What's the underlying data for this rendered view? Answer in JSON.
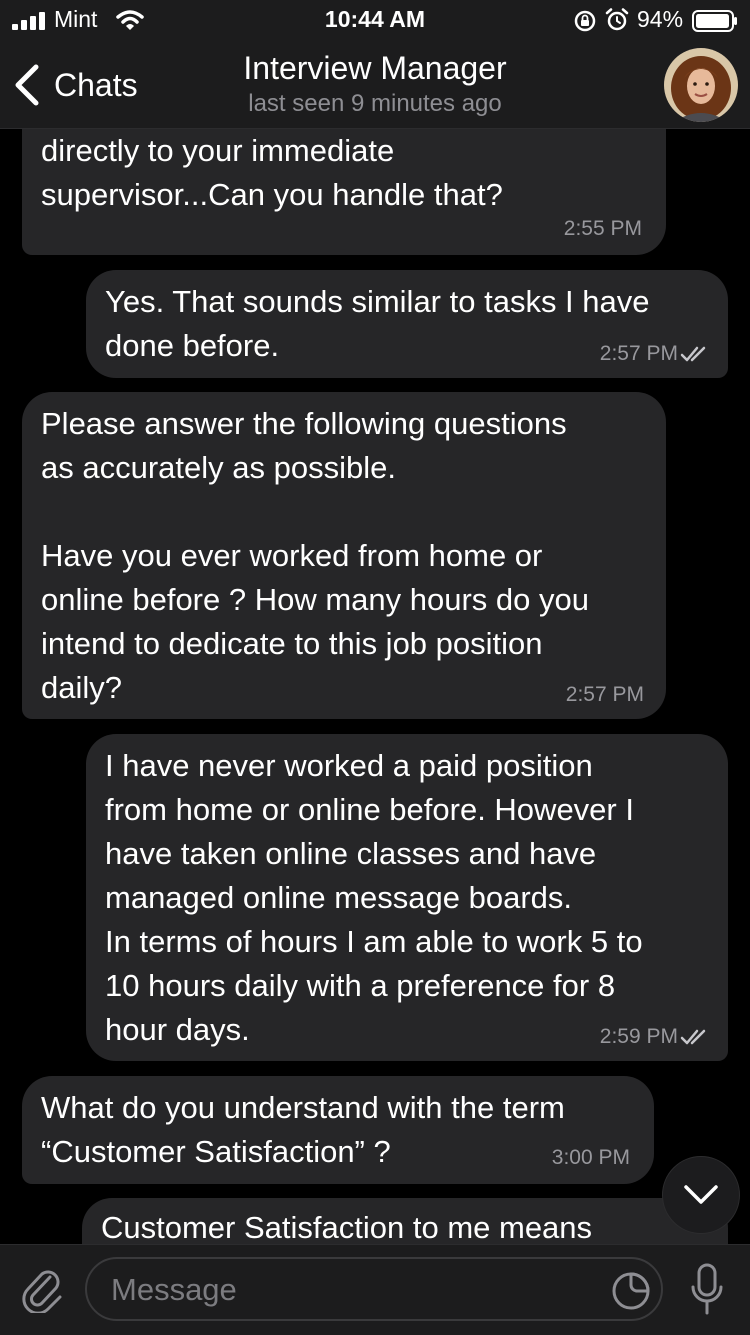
{
  "status_bar": {
    "carrier": "Mint",
    "time": "10:44 AM",
    "battery": "94%"
  },
  "header": {
    "back_label": "Chats",
    "title": "Interview Manager",
    "subtitle": "last seen 9 minutes ago"
  },
  "messages": [
    {
      "direction": "in",
      "text": "directly to your immediate\nsupervisor...Can you handle that?",
      "time": "2:55 PM"
    },
    {
      "direction": "out",
      "text": "Yes. That sounds similar to tasks I have\ndone before.",
      "time": "2:57 PM",
      "read": true
    },
    {
      "direction": "in",
      "text": "Please answer the following questions\nas accurately as possible.\n\nHave you ever worked from home or\nonline before ? How many hours do you\nintend to dedicate to this job position\ndaily?",
      "time": "2:57 PM"
    },
    {
      "direction": "out",
      "text": "I have never worked a paid position\nfrom home or online before. However I\nhave taken online classes and have\nmanaged online message boards.\nIn terms of hours I am able to work 5 to\n10 hours daily with a preference for 8\nhour days.",
      "time": "2:59 PM",
      "read": true
    },
    {
      "direction": "in",
      "text": "What do you understand with the term\n“Customer Satisfaction” ?",
      "time": "3:00 PM"
    },
    {
      "direction": "out",
      "text": "Customer Satisfaction to me means"
    }
  ],
  "input": {
    "placeholder": "Message"
  },
  "icons": {
    "signal": "signal-bars-icon",
    "wifi": "wifi-icon",
    "orientation_lock": "orientation-lock-icon",
    "alarm": "alarm-icon",
    "battery": "battery-icon",
    "back": "chevron-left-icon",
    "scroll_down": "chevron-down-icon",
    "attach": "paperclip-icon",
    "sticker": "sticker-icon",
    "mic": "microphone-icon"
  },
  "colors": {
    "background": "#000000",
    "bars": "#1c1c1d",
    "bubble": "#262628",
    "text": "#ffffff",
    "muted": "#8e8e93"
  }
}
